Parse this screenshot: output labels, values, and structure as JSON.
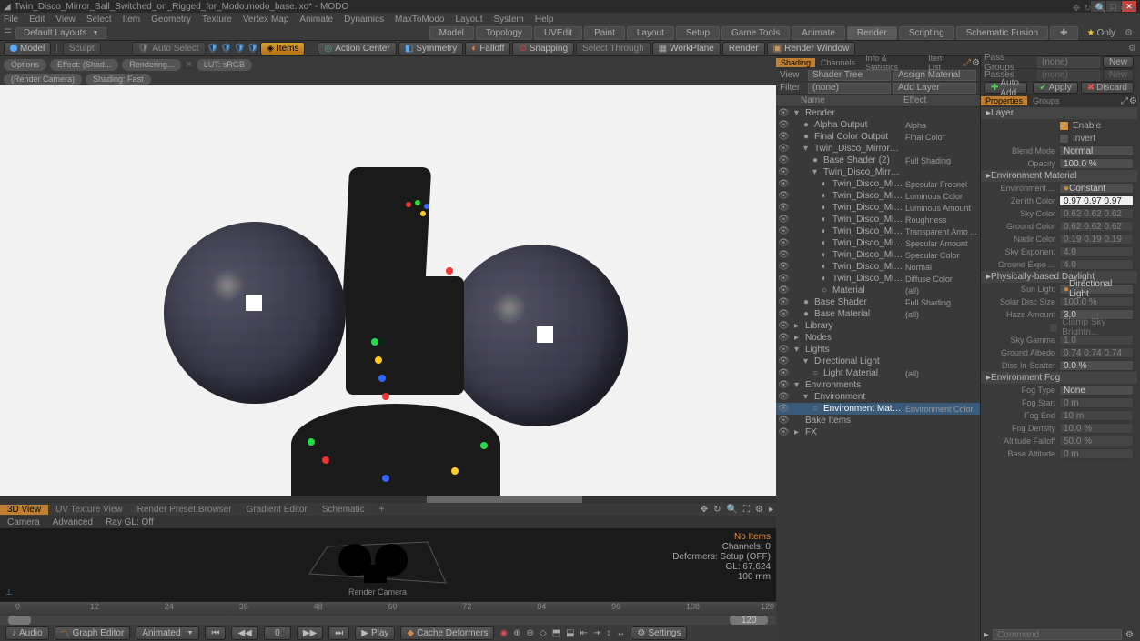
{
  "title": "Twin_Disco_Mirror_Ball_Switched_on_Rigged_for_Modo.modo_base.lxo* - MODO",
  "menus": [
    "File",
    "Edit",
    "View",
    "Select",
    "Item",
    "Geometry",
    "Texture",
    "Vertex Map",
    "Animate",
    "Dynamics",
    "MaxToModo",
    "Layout",
    "System",
    "Help"
  ],
  "layout_selector": "Default Layouts",
  "main_tabs": [
    "Model",
    "Topology",
    "UVEdit",
    "Paint",
    "Layout",
    "Setup",
    "Game Tools",
    "Animate",
    "Render",
    "Scripting",
    "Schematic Fusion"
  ],
  "main_tab_active": "Render",
  "only_label": "Only",
  "toolbar": {
    "model": "Model",
    "sculpt": "Sculpt",
    "auto_select": "Auto Select",
    "items": "Items",
    "action_center": "Action Center",
    "symmetry": "Symmetry",
    "falloff": "Falloff",
    "snapping": "Snapping",
    "select_through": "Select Through",
    "workplane": "WorkPlane",
    "render": "Render",
    "render_window": "Render Window"
  },
  "vp_pills": [
    "Options",
    "Effect: (Shad...",
    "Rendering...",
    "LUT: sRGB",
    "(Render Camera)",
    "Shading: Fast"
  ],
  "vp_tabs": [
    "3D View",
    "UV Texture View",
    "Render Preset Browser",
    "Gradient Editor",
    "Schematic",
    "+"
  ],
  "vp_sub": [
    "Camera",
    "Advanced",
    "Ray GL: Off"
  ],
  "lower_info": {
    "no_items": "No Items",
    "channels": "Channels: 0",
    "deformers": "Deformers: Setup (OFF)",
    "gl": "GL: 67,624",
    "mm": "100 mm"
  },
  "render_camera_label": "Render Camera",
  "timeline": {
    "start": "0",
    "end": "120",
    "ticks": [
      "0",
      "12",
      "24",
      "36",
      "48",
      "60",
      "72",
      "84",
      "96",
      "108",
      "120"
    ]
  },
  "play": {
    "audio": "Audio",
    "graph": "Graph Editor",
    "mode": "Animated",
    "frame": "0",
    "play": "Play",
    "cache": "Cache Deformers",
    "settings": "Settings"
  },
  "passes": {
    "pass_groups": "Pass Groups",
    "passes": "Passes",
    "none": "(none)",
    "new": "New"
  },
  "action_btns": {
    "auto_add": "Auto Add",
    "apply": "Apply",
    "discard": "Discard"
  },
  "shader_tabs": [
    "Shading",
    "Channels",
    "Info & Statistics",
    "Item List"
  ],
  "shader_view": {
    "view": "View",
    "view_val": "Shader Tree",
    "assign": "Assign Material",
    "filter": "Filter",
    "filter_val": "(none)",
    "add": "Add Layer"
  },
  "tree_header": {
    "name": "Name",
    "effect": "Effect"
  },
  "tree": [
    {
      "ind": 0,
      "icon": "▾",
      "name": "Render",
      "effect": ""
    },
    {
      "ind": 1,
      "icon": "●",
      "name": "Alpha Output",
      "effect": "Alpha"
    },
    {
      "ind": 1,
      "icon": "●",
      "name": "Final Color Output",
      "effect": "Final Color"
    },
    {
      "ind": 1,
      "icon": "▾",
      "name": "Twin_Disco_Mirror_Ball_Swit ...",
      "effect": ""
    },
    {
      "ind": 2,
      "icon": "●",
      "name": "Base Shader (2)",
      "effect": "Full Shading"
    },
    {
      "ind": 2,
      "icon": "▾",
      "name": "Twin_Disco_Mirror_Ball_Ri...",
      "effect": ""
    },
    {
      "ind": 3,
      "icon": "◐",
      "name": "Twin_Disco_Mirror_Ball ...",
      "effect": "Specular Fresnel"
    },
    {
      "ind": 3,
      "icon": "◐",
      "name": "Twin_Disco_Mirror_Ball ...",
      "effect": "Luminous Color"
    },
    {
      "ind": 3,
      "icon": "◐",
      "name": "Twin_Disco_Mirror_Ball ...",
      "effect": "Luminous Amount"
    },
    {
      "ind": 3,
      "icon": "◐",
      "name": "Twin_Disco_Mirror_Ball ...",
      "effect": "Roughness"
    },
    {
      "ind": 3,
      "icon": "◐",
      "name": "Twin_Disco_Mirror_Ball ...",
      "effect": "Transparent Amo ..."
    },
    {
      "ind": 3,
      "icon": "◐",
      "name": "Twin_Disco_Mirror_Ball ...",
      "effect": "Specular Amount"
    },
    {
      "ind": 3,
      "icon": "◐",
      "name": "Twin_Disco_Mirror_Ball ...",
      "effect": "Specular Color"
    },
    {
      "ind": 3,
      "icon": "◐",
      "name": "Twin_Disco_Mirror_Ball ...",
      "effect": "Normal"
    },
    {
      "ind": 3,
      "icon": "◐",
      "name": "Twin_Disco_Mirror_Ball ...",
      "effect": "Diffuse Color"
    },
    {
      "ind": 3,
      "icon": "○",
      "name": "Material",
      "effect": "(all)"
    },
    {
      "ind": 1,
      "icon": "●",
      "name": "Base Shader",
      "effect": "Full Shading"
    },
    {
      "ind": 1,
      "icon": "●",
      "name": "Base Material",
      "effect": "(all)"
    },
    {
      "ind": 0,
      "icon": "▸",
      "name": "Library",
      "effect": ""
    },
    {
      "ind": 0,
      "icon": "▸",
      "name": "Nodes",
      "effect": ""
    },
    {
      "ind": 0,
      "icon": "▾",
      "name": "Lights",
      "effect": ""
    },
    {
      "ind": 1,
      "icon": "▾",
      "name": "Directional Light",
      "effect": ""
    },
    {
      "ind": 2,
      "icon": "○",
      "name": "Light Material",
      "effect": "(all)"
    },
    {
      "ind": 0,
      "icon": "▾",
      "name": "Environments",
      "effect": ""
    },
    {
      "ind": 1,
      "icon": "▾",
      "name": "Environment",
      "effect": ""
    },
    {
      "ind": 2,
      "icon": "○",
      "name": "Environment Material",
      "effect": "Environment Color",
      "sel": true
    },
    {
      "ind": 0,
      "icon": " ",
      "name": "Bake Items",
      "effect": ""
    },
    {
      "ind": 0,
      "icon": "▸",
      "name": "FX",
      "effect": ""
    }
  ],
  "prop_tabs": [
    "Properties",
    "Groups"
  ],
  "prop": {
    "layer_head": "Layer",
    "enable": "Enable",
    "invert": "Invert",
    "blend_mode": "Blend Mode",
    "blend_val": "Normal",
    "opacity": "Opacity",
    "opacity_val": "100.0 %",
    "env_head": "Environment Material",
    "env_type": "Environment ...",
    "env_type_val": "Constant",
    "zenith": "Zenith Color",
    "zenith_val": "0.97  0.97  0.97",
    "sky": "Sky Color",
    "sky_val": "0.62  0.62  0.62",
    "ground": "Ground Color",
    "ground_val": "0.62  0.62  0.62",
    "nadir": "Nadir Color",
    "nadir_val": "0.19  0.19  0.19",
    "sky_exp": "Sky Exponent",
    "sky_exp_val": "4.0",
    "ground_exp": "Ground Expo ...",
    "ground_exp_val": "4.0",
    "pbd_head": "Physically-based Daylight",
    "sun": "Sun Light",
    "sun_val": "Directional Light",
    "solar": "Solar Disc Size",
    "solar_val": "100.0 %",
    "haze": "Haze Amount",
    "haze_val": "3.0",
    "clamp": "Clamp Sky Brightn...",
    "sky_gamma": "Sky Gamma",
    "sky_gamma_val": "1.0",
    "albedo": "Ground Albedo",
    "albedo_val": "0.74  0.74  0.74",
    "disc": "Disc In-Scatter",
    "disc_val": "0.0 %",
    "fog_head": "Environment Fog",
    "fog_type": "Fog Type",
    "fog_type_val": "None",
    "fog_start": "Fog Start",
    "fog_start_val": "0 m",
    "fog_end": "Fog End",
    "fog_end_val": "10 m",
    "fog_density": "Fog Density",
    "fog_density_val": "10.0 %",
    "alt_falloff": "Altitude Falloff",
    "alt_falloff_val": "50.0 %",
    "base_alt": "Base Altitude",
    "base_alt_val": "0 m"
  },
  "command": "Command"
}
